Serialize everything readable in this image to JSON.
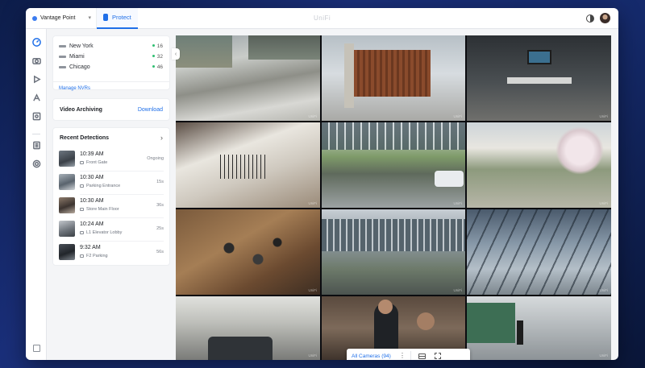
{
  "topbar": {
    "site_name": "Vantage Point",
    "app_tab_label": "Protect",
    "brand": "UniFi"
  },
  "rail": {
    "icons": [
      "dashboard-icon",
      "camera-icon",
      "play-icon",
      "alarm-icon",
      "detections-icon",
      "storage-icon",
      "settings-icon"
    ]
  },
  "nvrs": {
    "items": [
      {
        "name": "New York",
        "count": "16",
        "status_color": "#2fbf71"
      },
      {
        "name": "Miami",
        "count": "32",
        "status_color": "#2fbf71"
      },
      {
        "name": "Chicago",
        "count": "46",
        "status_color": "#2fbf71"
      }
    ],
    "manage_label": "Manage NVRs"
  },
  "archiving": {
    "title": "Video Archiving",
    "action": "Download"
  },
  "detections": {
    "title": "Recent Detections",
    "items": [
      {
        "time": "10:39 AM",
        "camera": "Front Gate",
        "duration": "Ongoing"
      },
      {
        "time": "10:30 AM",
        "camera": "Parking Entrance",
        "duration": "15s"
      },
      {
        "time": "10:30 AM",
        "camera": "Store Main Floor",
        "duration": "36s"
      },
      {
        "time": "10:24 AM",
        "camera": "L1 Elevator Lobby",
        "duration": "25s"
      },
      {
        "time": "9:32 AM",
        "camera": "F2 Parking",
        "duration": "56s"
      }
    ]
  },
  "grid": {
    "camera_selector": "All Cameras (94)",
    "watermark": "UniFi"
  },
  "colors": {
    "accent": "#1f6fe8",
    "online": "#2fbf71"
  }
}
